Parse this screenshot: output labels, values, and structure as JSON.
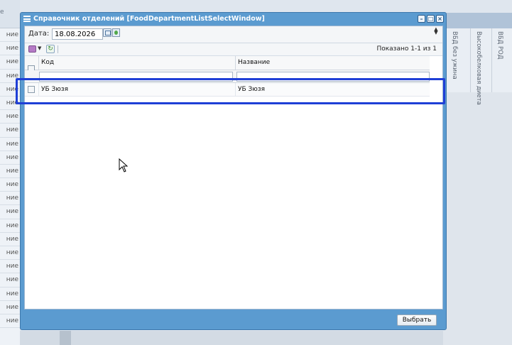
{
  "background": {
    "left_header": "е",
    "left_rows": [
      "ние",
      "ние",
      "ние",
      "ние",
      "ние",
      "ние",
      "ние",
      "ние",
      "ние",
      "ние",
      "ние",
      "ние",
      "ние",
      "ние",
      "ние",
      "ние",
      "ние",
      "ние",
      "ние",
      "ние",
      "ние",
      "ние"
    ],
    "columns": [
      "ВБД без ужина",
      "Высокобелковая диета",
      "ВБД РОД"
    ]
  },
  "window": {
    "title": "Справочник отделений [FoodDepartmentListSelectWindow]",
    "date_label": "Дата:",
    "date_value": "18.08.2026",
    "paging_info": "Показано 1-1 из 1",
    "columns": {
      "code": "Код",
      "name": "Название"
    },
    "rows": [
      {
        "code": "УБ Зюзя",
        "name": "УБ Зюзя"
      }
    ],
    "select_button": "Выбрать"
  },
  "icons": [
    "menu-icon",
    "minimize-icon",
    "maximize-icon",
    "close-icon",
    "calendar-icon",
    "clear-icon",
    "add-menu-icon",
    "refresh-icon",
    "cursor-icon"
  ]
}
